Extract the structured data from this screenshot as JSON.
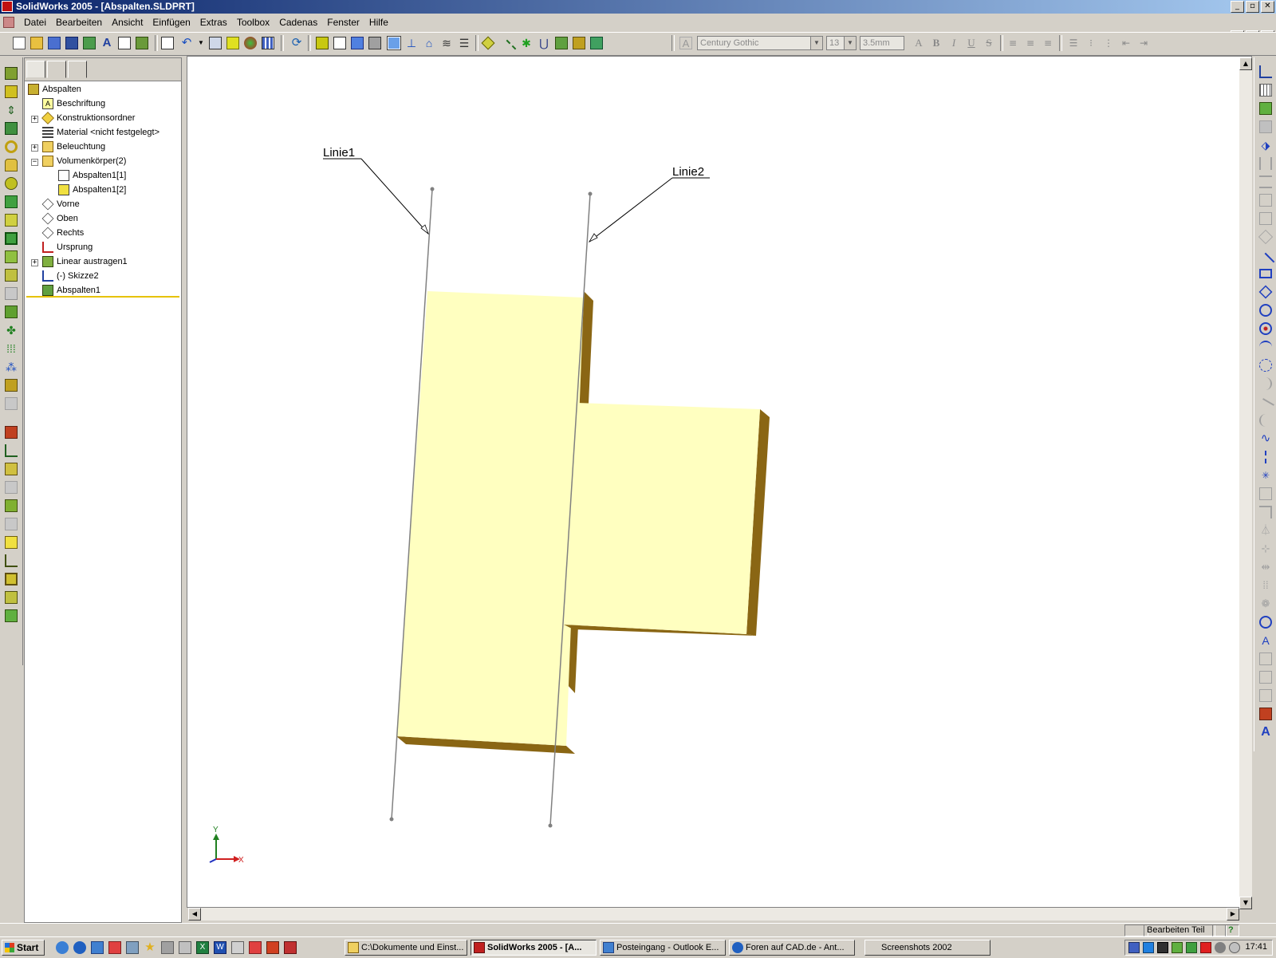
{
  "window": {
    "title": "SolidWorks 2005 - [Abspalten.SLDPRT]"
  },
  "menu": [
    "Datei",
    "Bearbeiten",
    "Ansicht",
    "Einfügen",
    "Extras",
    "Toolbox",
    "Cadenas",
    "Fenster",
    "Hilfe"
  ],
  "format_toolbar": {
    "font": "Century Gothic",
    "size": "13",
    "height": "3.5mm",
    "bold": "B",
    "italic": "I",
    "underline": "U",
    "strike": "S"
  },
  "feature_tree": {
    "items": [
      {
        "label": "Abspalten",
        "icon": "part-icon"
      },
      {
        "label": "Beschriftung",
        "icon": "annotations-icon"
      },
      {
        "label": "Konstruktionsordner",
        "icon": "design-binder-icon"
      },
      {
        "label": "Material <nicht festgelegt>",
        "icon": "material-icon"
      },
      {
        "label": "Beleuchtung",
        "icon": "lighting-icon"
      },
      {
        "label": "Volumenkörper(2)",
        "icon": "solid-bodies-folder-icon"
      },
      {
        "label": "Abspalten1[1]",
        "icon": "solid-body-icon"
      },
      {
        "label": "Abspalten1[2]",
        "icon": "solid-body-icon"
      },
      {
        "label": "Vorne",
        "icon": "plane-icon"
      },
      {
        "label": "Oben",
        "icon": "plane-icon"
      },
      {
        "label": "Rechts",
        "icon": "plane-icon"
      },
      {
        "label": "Ursprung",
        "icon": "origin-icon"
      },
      {
        "label": "Linear austragen1",
        "icon": "extrude-icon"
      },
      {
        "label": "(-) Skizze2",
        "icon": "sketch-icon"
      },
      {
        "label": "Abspalten1",
        "icon": "split-icon"
      }
    ]
  },
  "viewport": {
    "callouts": {
      "line1": "Linie1",
      "line2": "Linie2"
    },
    "triad": {
      "x": "X",
      "y": "Y"
    },
    "colors": {
      "face": "#ffffc0",
      "side": "#8a6614",
      "sketch_line": "#808080"
    }
  },
  "statusbar": {
    "mode": "Bearbeiten Teil",
    "help": "?"
  },
  "taskbar": {
    "start": "Start",
    "tasks": [
      {
        "label": "C:\\Dokumente und Einst...",
        "icon": "folder-icon"
      },
      {
        "label": "SolidWorks 2005 - [A...",
        "icon": "solidworks-icon",
        "active": true
      },
      {
        "label": "Posteingang - Outlook E...",
        "icon": "outlook-icon"
      },
      {
        "label": "Foren auf CAD.de - Ant...",
        "icon": "browser-icon"
      },
      {
        "label": "Screenshots 2002",
        "icon": ""
      }
    ],
    "clock": "17:41"
  }
}
